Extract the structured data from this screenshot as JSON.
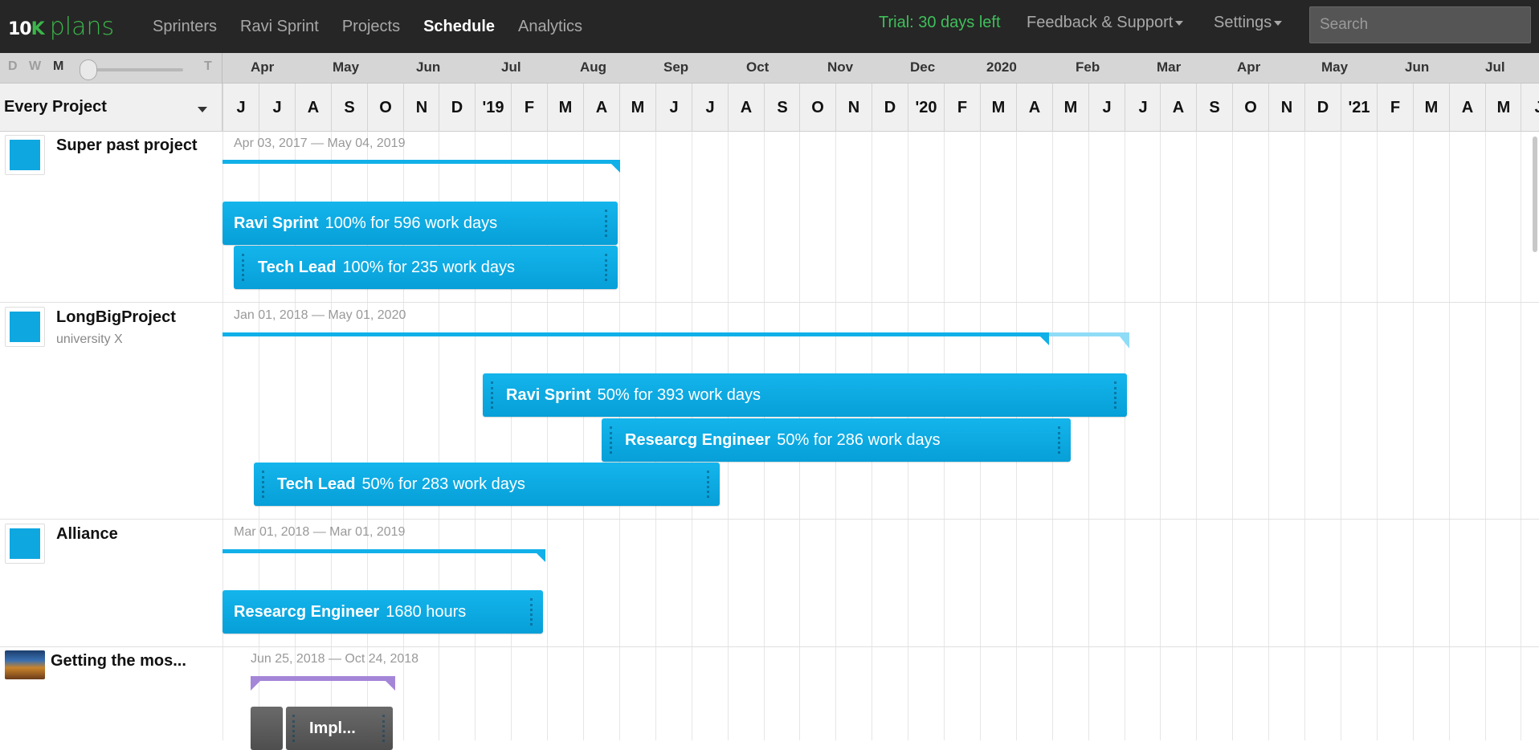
{
  "nav": {
    "logo_ten": "10",
    "logo_k": "K",
    "logo_plans": "plans",
    "links": [
      "Sprinters",
      "Ravi Sprint",
      "Projects",
      "Schedule",
      "Analytics"
    ],
    "active": "Schedule",
    "trial": "Trial: 30 days left",
    "feedback": "Feedback & Support",
    "settings": "Settings",
    "search_placeholder": "Search"
  },
  "zoom": {
    "levels": [
      "D",
      "W",
      "M",
      "T"
    ],
    "selected": "M"
  },
  "timeline": {
    "months_top": [
      "Apr",
      "May",
      "Jun",
      "Jul",
      "Aug",
      "Sep",
      "Oct",
      "Nov",
      "Dec",
      "2020",
      "Feb",
      "Mar",
      "Apr",
      "May",
      "Jun",
      "Jul"
    ],
    "month_letters": [
      "J",
      "J",
      "A",
      "S",
      "O",
      "N",
      "D",
      "'19",
      "F",
      "M",
      "A",
      "M",
      "J",
      "J",
      "A",
      "S",
      "O",
      "N",
      "D",
      "'20",
      "F",
      "M",
      "A",
      "M",
      "J",
      "J",
      "A",
      "S",
      "O",
      "N",
      "D",
      "'21",
      "F",
      "M",
      "A",
      "M",
      "J"
    ]
  },
  "filter": {
    "label": "Every Project"
  },
  "projects": [
    {
      "name": "Super past project",
      "subtitle": "",
      "dates": "Apr 03, 2017 — May 04, 2019",
      "color": "#11b0e8",
      "assignments": [
        {
          "who": "Ravi Sprint",
          "detail": "100% for 596 work days"
        },
        {
          "who": "Tech Lead",
          "detail": "100% for 235 work days"
        }
      ]
    },
    {
      "name": "LongBigProject",
      "subtitle": "university X",
      "dates": "Jan 01, 2018 — May 01, 2020",
      "color": "#11b0e8",
      "assignments": [
        {
          "who": "Ravi Sprint",
          "detail": "50% for 393 work days"
        },
        {
          "who": "Researcg Engineer",
          "detail": "50% for 286 work days"
        },
        {
          "who": "Tech Lead",
          "detail": "50% for 283 work days"
        }
      ]
    },
    {
      "name": "Alliance",
      "subtitle": "",
      "dates": "Mar 01, 2018 — Mar 01, 2019",
      "color": "#11b0e8",
      "assignments": [
        {
          "who": "Researcg Engineer",
          "detail": "1680 hours"
        }
      ]
    },
    {
      "name": "Getting the mos...",
      "subtitle": "",
      "dates": "Jun 25, 2018 — Oct 24, 2018",
      "color": "#a486d8",
      "assignments": [
        {
          "who": "Impl...",
          "detail": ""
        }
      ]
    }
  ]
}
